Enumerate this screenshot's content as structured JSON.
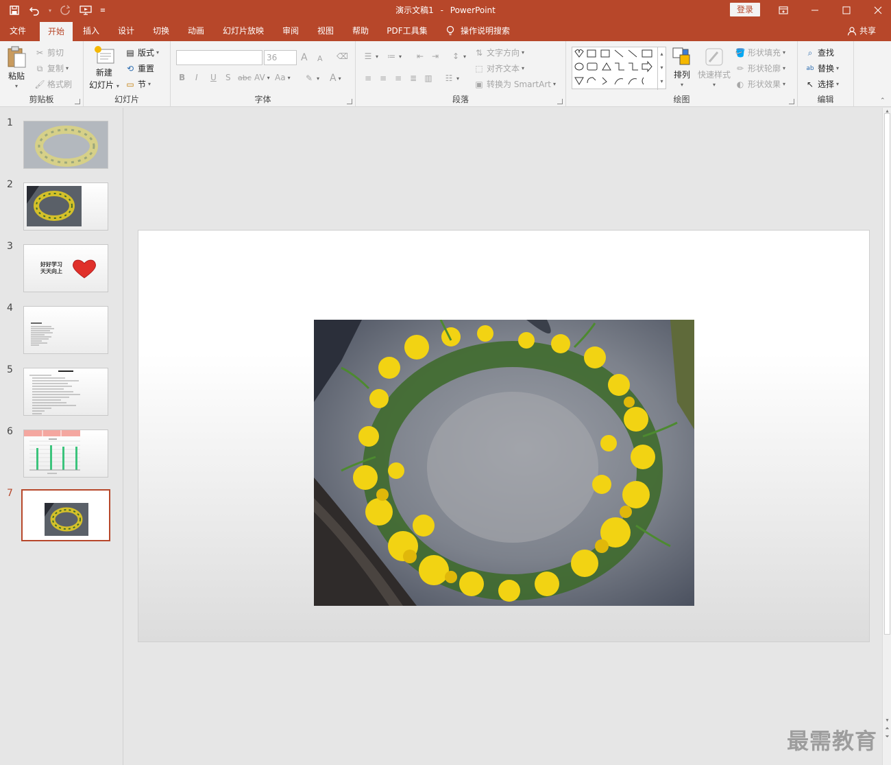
{
  "titlebar": {
    "document_title": "演示文稿1",
    "separator": "-",
    "app_name": "PowerPoint",
    "login_label": "登录"
  },
  "tabs": [
    {
      "label": "文件"
    },
    {
      "label": "开始"
    },
    {
      "label": "插入"
    },
    {
      "label": "设计"
    },
    {
      "label": "切换"
    },
    {
      "label": "动画"
    },
    {
      "label": "幻灯片放映"
    },
    {
      "label": "审阅"
    },
    {
      "label": "视图"
    },
    {
      "label": "帮助"
    },
    {
      "label": "PDF工具集"
    }
  ],
  "active_tab": "开始",
  "tell_me": "操作说明搜索",
  "share_label": "共享",
  "ribbon": {
    "clipboard": {
      "paste": "粘贴",
      "cut": "剪切",
      "copy": "复制",
      "format_painter": "格式刷",
      "label": "剪贴板"
    },
    "slides": {
      "new_slide_line1": "新建",
      "new_slide_line2": "幻灯片",
      "layout": "版式",
      "reset": "重置",
      "section": "节",
      "label": "幻灯片"
    },
    "font": {
      "font_name": "",
      "font_size": "36",
      "bold": "B",
      "italic": "I",
      "underline": "U",
      "shadow": "S",
      "strike": "abc",
      "spacing": "AV",
      "case": "Aa",
      "grow": "A",
      "shrink": "A",
      "color": "A",
      "label": "字体"
    },
    "paragraph": {
      "text_direction": "文字方向",
      "align_text": "对齐文本",
      "smartart": "转换为 SmartArt",
      "label": "段落"
    },
    "drawing": {
      "arrange": "排列",
      "quick_styles": "快速样式",
      "shape_fill": "形状填充",
      "shape_outline": "形状轮廓",
      "shape_effects": "形状效果",
      "label": "绘图"
    },
    "editing": {
      "find": "查找",
      "replace": "替换",
      "select": "选择",
      "label": "编辑"
    }
  },
  "thumbnails": [
    {
      "number": "1"
    },
    {
      "number": "2"
    },
    {
      "number": "3",
      "text_line1": "好好学习",
      "text_line2": "天天向上"
    },
    {
      "number": "4"
    },
    {
      "number": "5"
    },
    {
      "number": "6"
    },
    {
      "number": "7"
    }
  ],
  "active_slide": 7,
  "watermark": "最需教育",
  "colors": {
    "accent": "#b7472a",
    "ribbon_bg": "#f3f3f3",
    "workspace_bg": "#e6e6e6",
    "heart": "#e0302a",
    "bar_green": "#3cc47c",
    "table_header": "#f4a7a0"
  }
}
